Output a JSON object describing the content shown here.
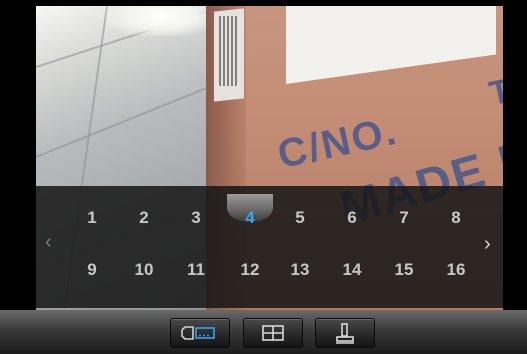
{
  "channels": {
    "row1": [
      "1",
      "2",
      "3",
      "4",
      "5",
      "6",
      "7",
      "8"
    ],
    "row2": [
      "9",
      "10",
      "11",
      "12",
      "13",
      "14",
      "15",
      "16"
    ],
    "selected": "4",
    "selected_color": "#3aa2ef",
    "prev_icon": "chevron-left-icon",
    "next_icon": "chevron-right-icon"
  },
  "toolbar": {
    "buttons": [
      {
        "icon": "camera-channel-icon"
      },
      {
        "icon": "grid-layout-icon"
      },
      {
        "icon": "joystick-icon"
      }
    ]
  },
  "feed": {
    "box_text_1": "C/NO.",
    "box_text_2": "MADE IN",
    "box_text_3": "T"
  }
}
